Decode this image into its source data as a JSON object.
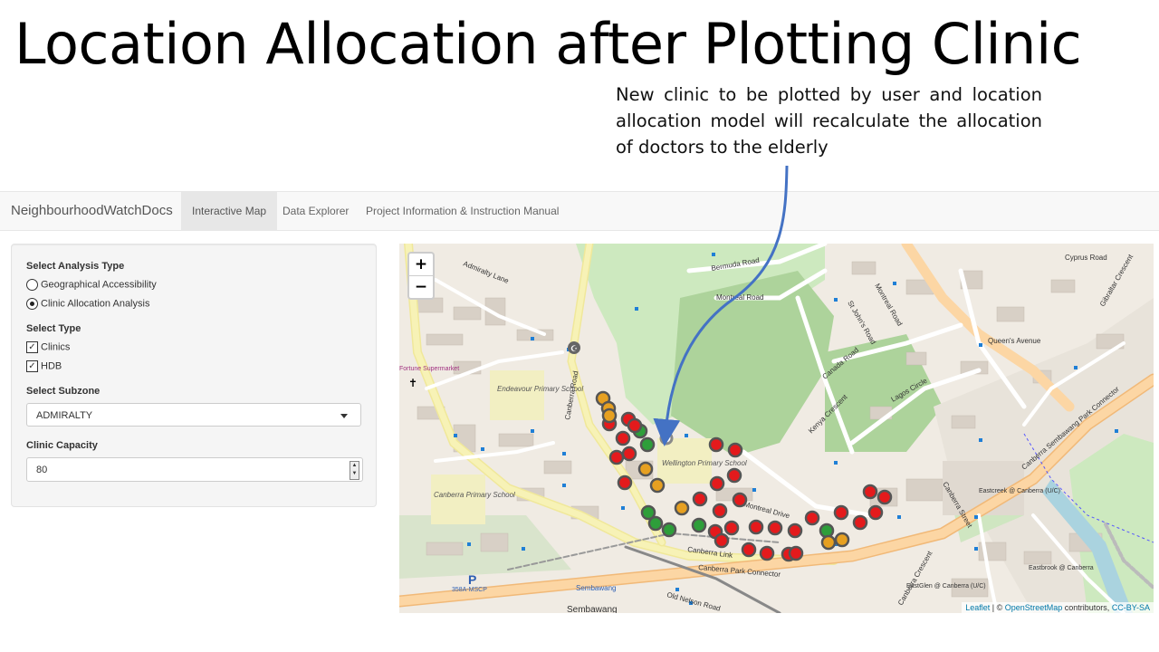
{
  "slide": {
    "title": "Location Allocation after Plotting Clinic",
    "callout": "New clinic to be plotted by user and location allocation model will recalculate the allocation of doctors to the elderly"
  },
  "navbar": {
    "brand": "NeighbourhoodWatchDocs",
    "tabs": [
      {
        "label": "Interactive Map",
        "active": true
      },
      {
        "label": "Data Explorer",
        "active": false
      },
      {
        "label": "Project Information & Instruction Manual",
        "active": false
      }
    ]
  },
  "sidebar": {
    "analysis_type_label": "Select Analysis Type",
    "analysis_options": [
      {
        "label": "Geographical Accessibility",
        "selected": false
      },
      {
        "label": "Clinic Allocation Analysis",
        "selected": true
      }
    ],
    "type_label": "Select Type",
    "type_options": [
      {
        "label": "Clinics",
        "checked": true
      },
      {
        "label": "HDB",
        "checked": true
      }
    ],
    "subzone_label": "Select Subzone",
    "subzone_value": "ADMIRALTY",
    "capacity_label": "Clinic Capacity",
    "capacity_value": "80"
  },
  "map": {
    "zoom_in": "+",
    "zoom_out": "−",
    "attribution": {
      "leaflet": "Leaflet",
      "sep": " | © ",
      "osm": "OpenStreetMap",
      "contrib": " contributors, ",
      "license": "CC-BY-SA"
    },
    "place_labels": {
      "admiralty_lane": "Admiralty Lane",
      "bermuda_road": "Bermuda Road",
      "montreal_road": "Montreal Road",
      "cyprus_road": "Cyprus Road",
      "gibraltar_crescent": "Gibraltar Crescent",
      "queens_avenue": "Queen's Avenue",
      "st_johns_road": "St John's Road",
      "canada_road": "Canada Road",
      "lagos_circle": "Lagos Circle",
      "kenya_crescent": "Kenya Crescent",
      "canberra_road": "Canberra Road",
      "endeavour_school": "Endeavour Primary School",
      "wellington_school": "Wellington Primary School",
      "canberra_school": "Canberra Primary School",
      "montreal_drive": "Montreal Drive",
      "canberra_link": "Canberra Link",
      "canberra_park_connector": "Canberra Park Connector",
      "old_nelson_road": "Old Nelson Road",
      "sembawang": "Sembawang",
      "sembawang_bottom": "Sembawang",
      "eastcreek": "Eastcreek @ Canberra (U/C)",
      "eastbrook": "Eastbrook @ Canberra",
      "eastglen": "EastGlen @ Canberra (U/C)",
      "canberra_street": "Canberra Street",
      "fortune_supermarket": "Fortune Supermarket",
      "mscp": "358A-MSCP",
      "canberra_crescent": "Canberra Crescent",
      "park_connector_right": "Canberra Sembawang Park Connector"
    },
    "marker_colors": {
      "red": "#e41a1c",
      "green": "#2e9e3a",
      "orange": "#e6a021",
      "grey": "#8a8a8a"
    },
    "markers_count": {
      "red": 38,
      "green": 9,
      "orange": 8,
      "new_clinic": 1
    }
  }
}
